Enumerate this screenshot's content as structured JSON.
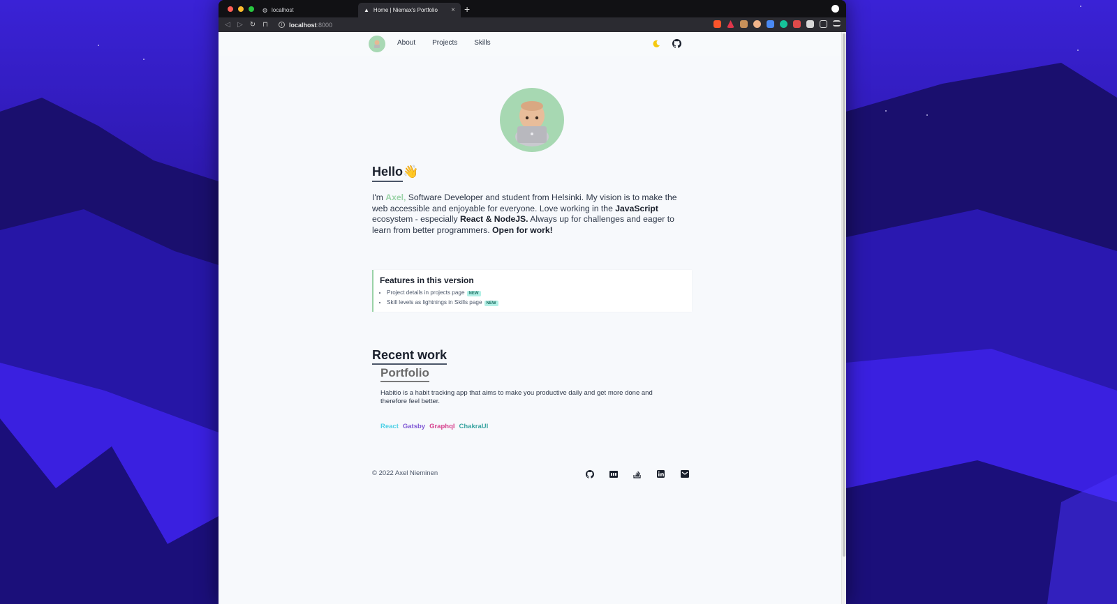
{
  "browser": {
    "tabs": [
      {
        "title": "localhost",
        "active": false
      },
      {
        "title": "Home | Niemax's Portfolio",
        "active": true
      }
    ],
    "new_tab_label": "+",
    "close_label": "×",
    "url_host": "localhost",
    "url_port": ":8000"
  },
  "nav": {
    "links": [
      "About",
      "Projects",
      "Skills"
    ]
  },
  "hero": {
    "heading": "Hello",
    "wave": "👋",
    "bio_intro": "I'm ",
    "bio_name": "Axel,",
    "bio_part1": " Software Developer and student from Helsinki. My vision is to make the web accessible and enjoyable for everyone. Love working in the ",
    "bio_js": "JavaScript",
    "bio_part2": " ecosystem - especially ",
    "bio_stack": "React & NodeJS.",
    "bio_part3": " Always up for challenges and eager to learn from better programmers. ",
    "bio_cta": "Open for work!"
  },
  "features": {
    "title": "Features in this version",
    "items": [
      {
        "text": "Project details in projects page",
        "badge": "NEW"
      },
      {
        "text": "Skill levels as lightnings in Skills page",
        "badge": "NEW"
      }
    ]
  },
  "recent": {
    "heading": "Recent work",
    "project_title": "Portfolio",
    "project_desc": "Habitio is a habit tracking app that aims to make you productive daily and get more done and therefore feel better.",
    "tags": [
      {
        "label": "React",
        "color": "#4fd1e6"
      },
      {
        "label": "Gatsby",
        "color": "#805ad5"
      },
      {
        "label": "Graphql",
        "color": "#d53f8c"
      },
      {
        "label": "ChakraUI",
        "color": "#38a3a0"
      }
    ]
  },
  "footer": {
    "copyright": "© 2022 Axel Nieminen",
    "icons": [
      "github-icon",
      "dev-icon",
      "stackoverflow-icon",
      "linkedin-icon",
      "mail-icon"
    ]
  },
  "colors": {
    "accent": "#9bd3a8",
    "page_bg": "#f7f9fc",
    "moon": "#f6c90e"
  }
}
